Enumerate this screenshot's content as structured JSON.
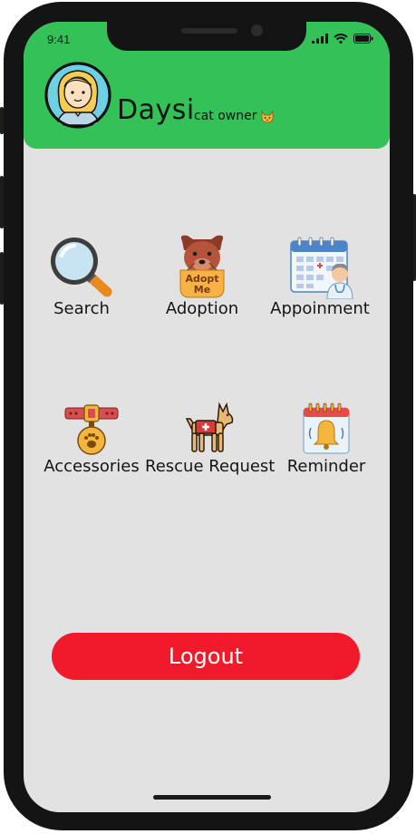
{
  "status_bar": {
    "time": "9:41"
  },
  "profile": {
    "name": "Daysi",
    "tag": "cat owner",
    "tag_icon": "cat-face-icon"
  },
  "menu": {
    "items": [
      {
        "label": "Search",
        "icon": "magnifier-icon"
      },
      {
        "label": "Adoption",
        "icon": "adopt-me-dog-icon"
      },
      {
        "label": "Appoinment",
        "icon": "calendar-doctor-icon"
      },
      {
        "label": "Accessories",
        "icon": "collar-tag-icon"
      },
      {
        "label": "Rescue Request",
        "icon": "rescue-dog-icon"
      },
      {
        "label": "Reminder",
        "icon": "calendar-bell-icon"
      }
    ]
  },
  "logout_label": "Logout",
  "colors": {
    "header": "#33c158",
    "screen_bg": "#e2e2e2",
    "logout": "#f01a2a"
  }
}
